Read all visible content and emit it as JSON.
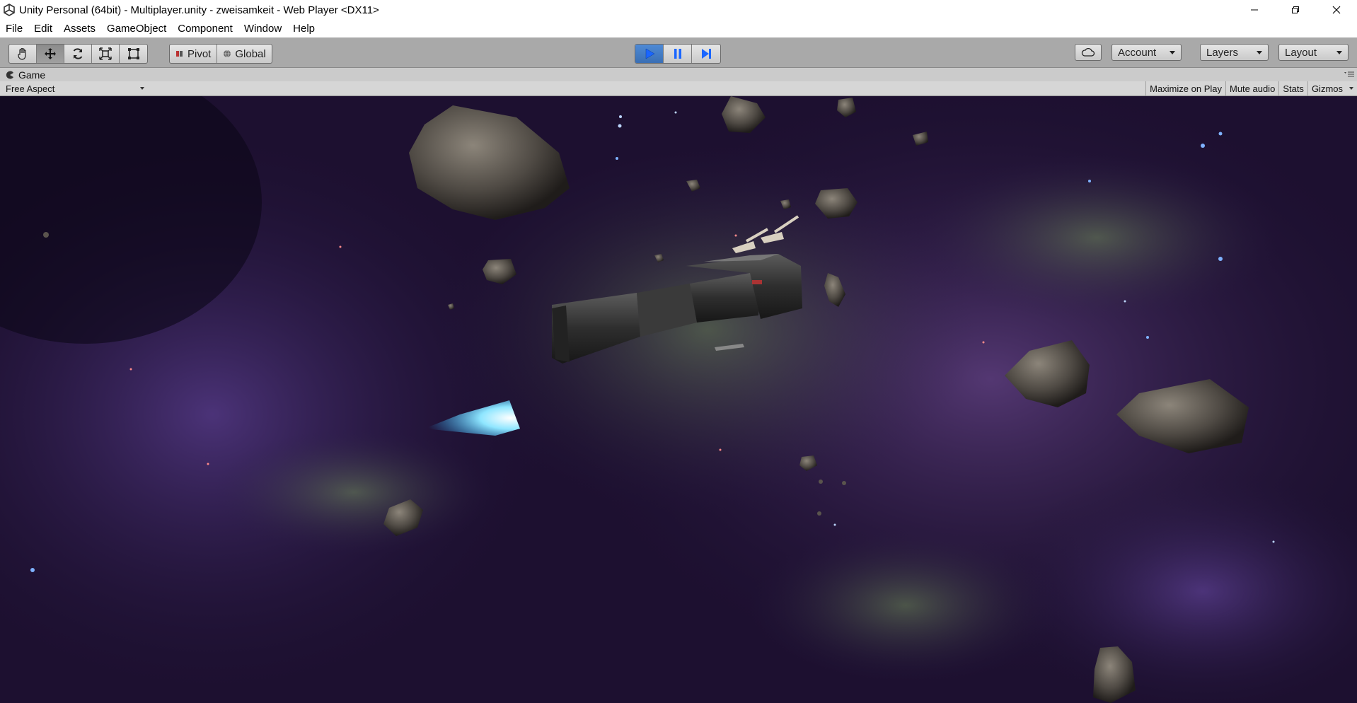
{
  "window": {
    "title": "Unity Personal (64bit) - Multiplayer.unity - zweisamkeit - Web Player <DX11>"
  },
  "menu": {
    "items": [
      "File",
      "Edit",
      "Assets",
      "GameObject",
      "Component",
      "Window",
      "Help"
    ]
  },
  "toolbar": {
    "tools": [
      "hand-tool-icon",
      "move-tool-icon",
      "rotate-tool-icon",
      "scale-tool-icon",
      "rect-tool-icon"
    ],
    "pivot_label": "Pivot",
    "global_label": "Global",
    "account_label": "Account",
    "layers_label": "Layers",
    "layout_label": "Layout"
  },
  "game_tab": {
    "label": "Game",
    "aspect": "Free Aspect",
    "options": {
      "maximize": "Maximize on Play",
      "mute": "Mute audio",
      "stats": "Stats",
      "gizmos": "Gizmos"
    }
  },
  "colors": {
    "play_active": "#3d76c4",
    "thruster": "#3fc6ff",
    "space_bg": "#1a0f2e"
  }
}
